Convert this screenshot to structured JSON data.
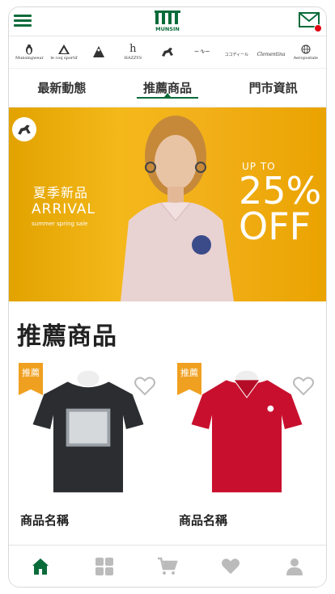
{
  "header": {
    "logo_text": "MUNSIN",
    "menu_icon": "hamburger-menu-icon",
    "mail_icon": "mail-icon",
    "colors": {
      "brand_green": "#0a6b3a",
      "badge_red": "#e00012"
    }
  },
  "brands": [
    {
      "name": "Munsingwear",
      "icon": "penguin-icon"
    },
    {
      "name": "le coq sportif",
      "icon": "rooster-icon"
    },
    {
      "name": "",
      "icon": "figure-icon"
    },
    {
      "name": "HAZZYS",
      "icon": "h-monogram-icon"
    },
    {
      "name": "",
      "icon": "horse-icon"
    },
    {
      "name": "",
      "icon": "script-logo-icon"
    },
    {
      "name": "ココディール",
      "icon": "text-logo-icon"
    },
    {
      "name": "Clementina",
      "icon": "script-logo-icon"
    },
    {
      "name": "Aeropostale",
      "icon": "globe-icon"
    }
  ],
  "tabs": [
    {
      "label": "最新動態",
      "active": false
    },
    {
      "label": "推薦商品",
      "active": true
    },
    {
      "label": "門市資訊",
      "active": false
    }
  ],
  "banner": {
    "line1": "夏季新品",
    "line2": "ARRIVAL",
    "line3": "summer spring sale",
    "upto": "UP TO",
    "percent": "25%",
    "off": "OFF",
    "background_color": "#f4b81a"
  },
  "section": {
    "title": "推薦商品"
  },
  "products": [
    {
      "ribbon": "推薦",
      "name": "商品名稱",
      "shirt_color": "#2b2d30"
    },
    {
      "ribbon": "推薦",
      "name": "商品名稱",
      "shirt_color": "#c8102e"
    }
  ],
  "bottom_nav": [
    {
      "icon": "home-icon",
      "active": true
    },
    {
      "icon": "grid-icon",
      "active": false
    },
    {
      "icon": "cart-icon",
      "active": false
    },
    {
      "icon": "heart-icon",
      "active": false
    },
    {
      "icon": "user-icon",
      "active": false
    }
  ]
}
